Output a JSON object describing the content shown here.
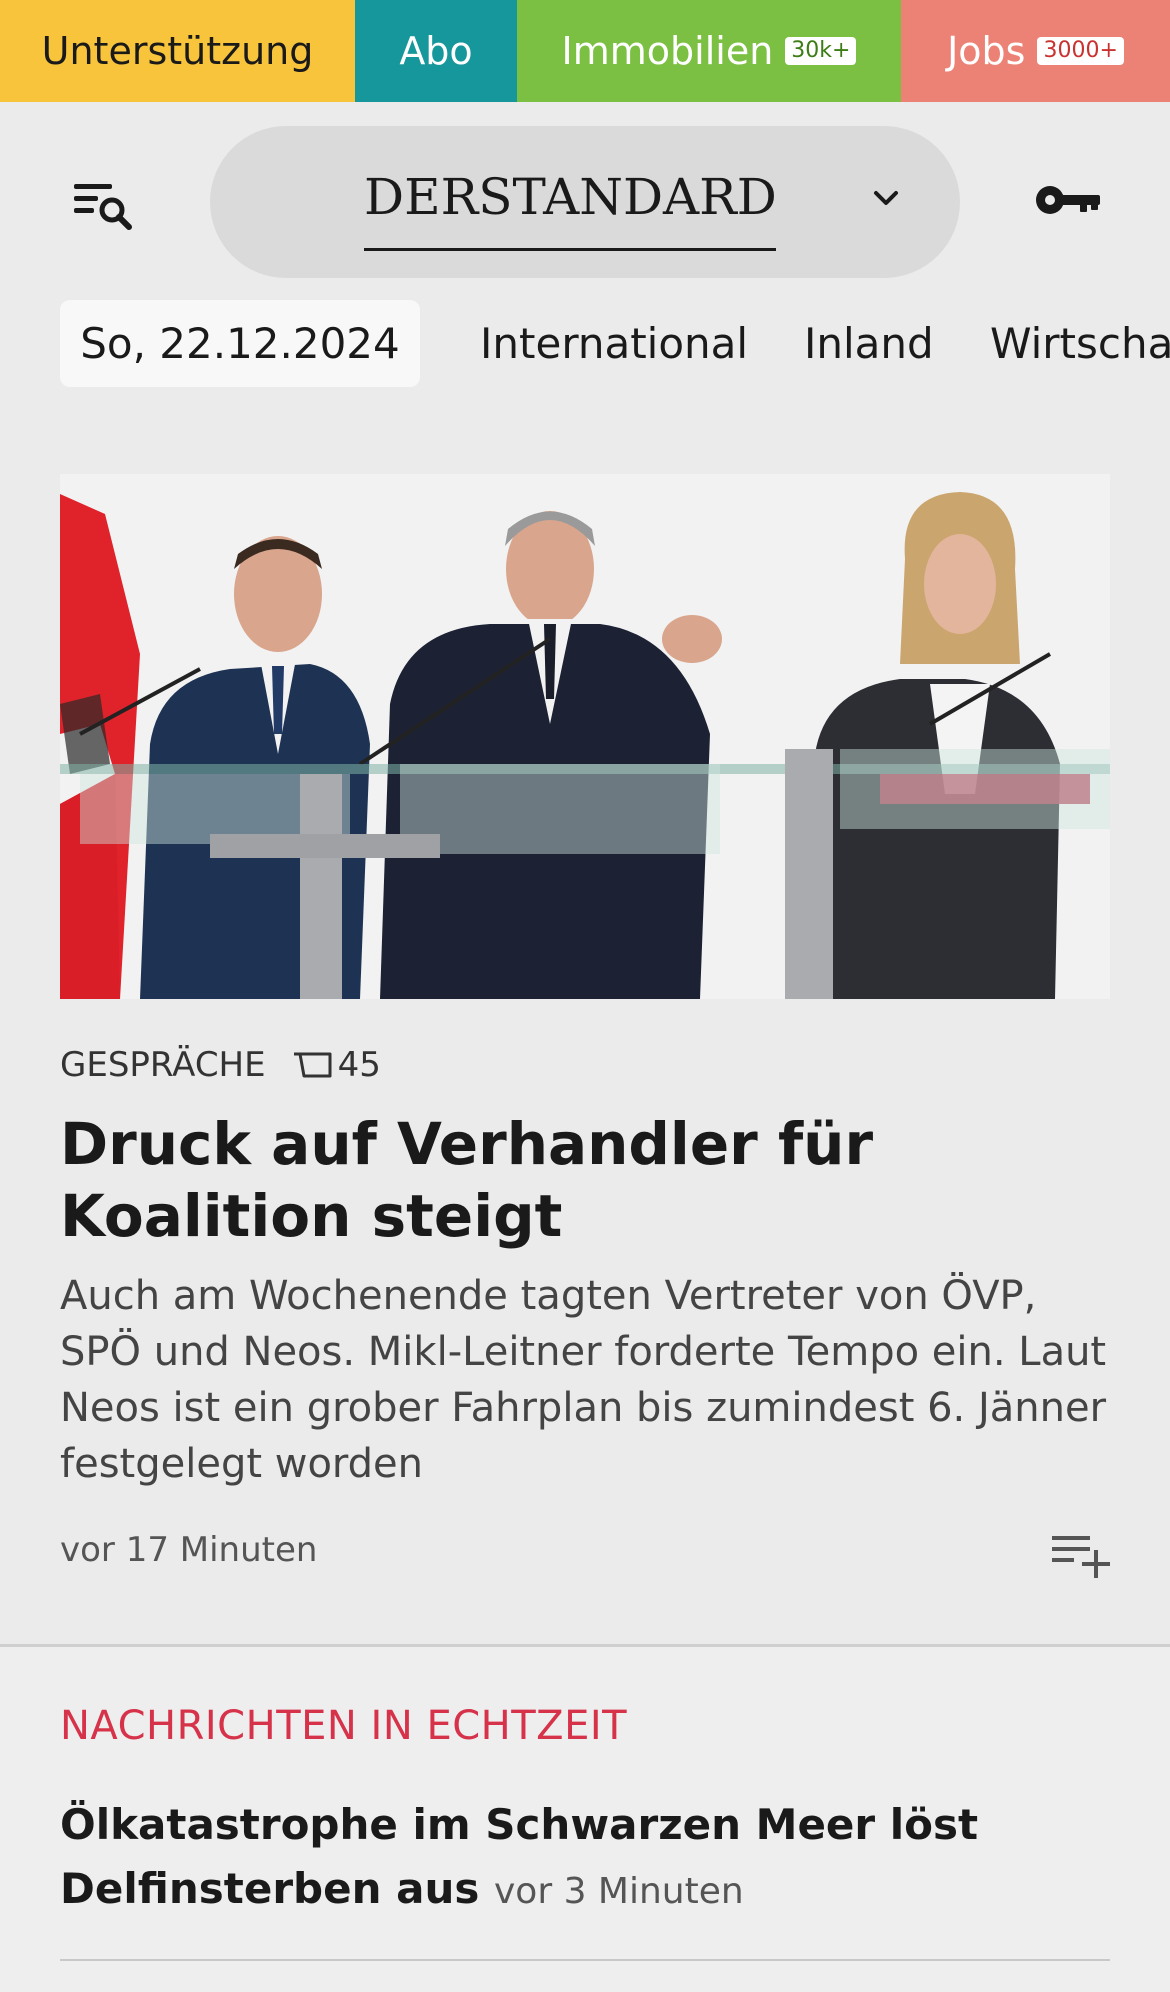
{
  "topbar": {
    "support": "Unterstützung",
    "abo": "Abo",
    "immobilien": "Immobilien",
    "immobilien_badge": "30k+",
    "jobs": "Jobs",
    "jobs_badge": "3000+",
    "colors": {
      "support": "#f7c43b",
      "abo": "#15979b",
      "immobilien": "#7cc043",
      "jobs": "#ec8275"
    }
  },
  "header": {
    "menu_icon": "menu-search-icon",
    "logo": "DERSTANDARD",
    "logo_dropdown_icon": "chevron-down-icon",
    "login_icon": "key-icon"
  },
  "nav": {
    "date": "So, 22.12.2024",
    "items": [
      "International",
      "Inland",
      "Wirtschaft"
    ]
  },
  "article": {
    "kicker": "GESPRÄCHE",
    "comment_icon": "comment-icon",
    "comment_count": "45",
    "headline": "Druck auf Verhandler für Koalition steigt",
    "teaser": "Auch am Wochenende tagten Vertreter von ÖVP, SPÖ und Neos. Mikl-Leitner forderte Tempo ein. Laut Neos ist ein grober Fahrplan bis zumindest 6. Jänner festgelegt worden",
    "time": "vor 17 Minuten",
    "add_icon": "playlist-add-icon"
  },
  "live": {
    "section_title": "NACHRICHTEN IN ECHTZEIT",
    "headline": "Ölkatastrophe im Schwarzen Meer löst Delfinsterben aus",
    "time": "vor 3 Minuten",
    "accent_color": "#d6334b"
  }
}
